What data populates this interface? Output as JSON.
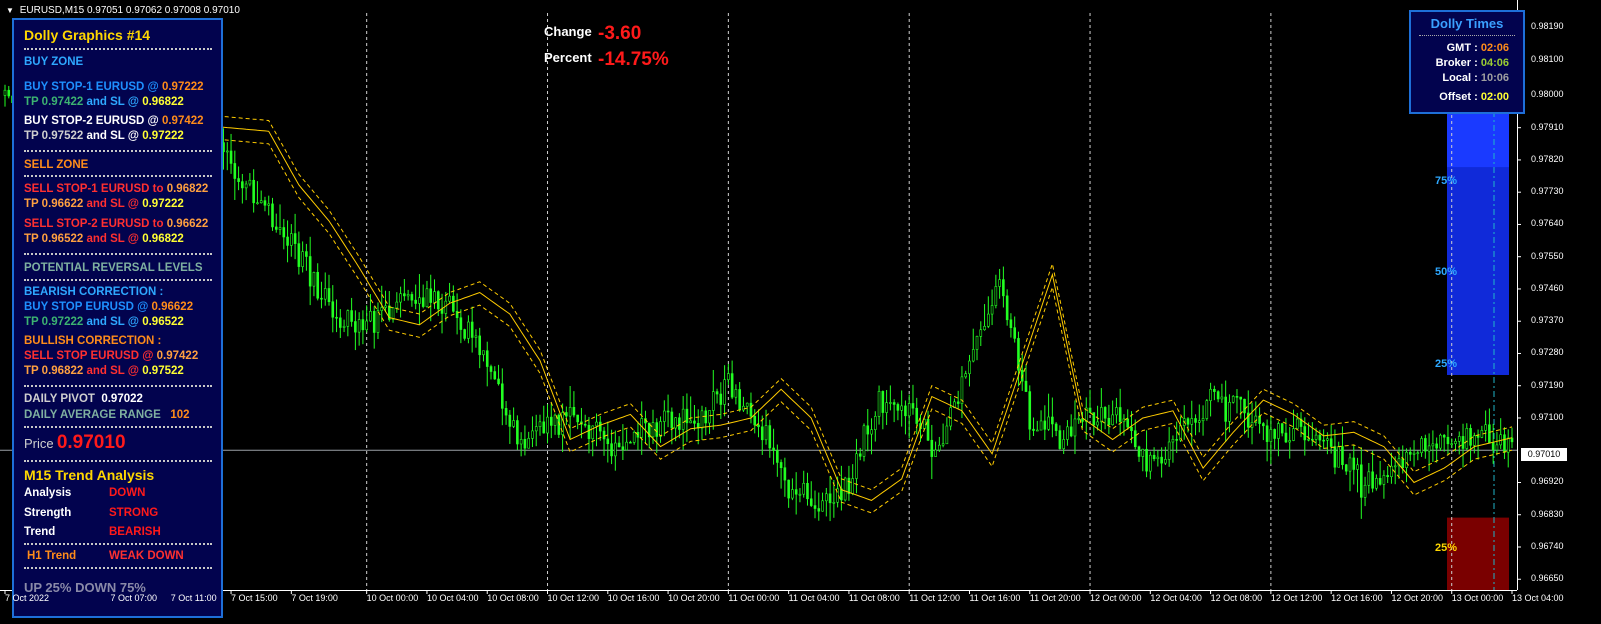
{
  "header": {
    "symbol": "EURUSD,M15",
    "ohlc": "0.97051 0.97062 0.97008 0.97010"
  },
  "change": {
    "change_label": "Change",
    "change_value": "-3.60",
    "percent_label": "Percent",
    "percent_value": "-14.75%"
  },
  "panel": {
    "title": "Dolly Graphics #14",
    "buy_zone": "BUY ZONE",
    "buy1_a": "BUY STOP-1  EURUSD  @",
    "buy1_price": "0.97222",
    "buy1_b": "TP 0.97422",
    "buy1_c": "and SL @",
    "buy1_sl": "0.96822",
    "buy2_a": "BUY STOP-2  EURUSD  @",
    "buy2_price": "0.97422",
    "buy2_b": "TP 0.97522",
    "buy2_c": "and SL @",
    "buy2_sl": "0.97222",
    "sell_zone": "SELL ZONE",
    "sell1_a": "SELL STOP-1  EURUSD to",
    "sell1_price": "0.96822",
    "sell1_b": "TP 0.96622",
    "sell1_c": "and SL @",
    "sell1_sl": "0.97222",
    "sell2_a": "SELL STOP-2  EURUSD to",
    "sell2_price": "0.96622",
    "sell2_b": "TP 0.96522",
    "sell2_c": "and SL @",
    "sell2_sl": "0.96822",
    "prl": "POTENTIAL REVERSAL LEVELS",
    "bear_title": "BEARISH CORRECTION :",
    "bear_a": "BUY STOP EURUSD  @",
    "bear_price": "0.96622",
    "bear_b": "TP 0.97222",
    "bear_c": "and SL @",
    "bear_sl": "0.96522",
    "bull_title": "BULLISH CORRECTION :",
    "bull_a": "SELL STOP EURUSD  @",
    "bull_price": "0.97422",
    "bull_b": "TP 0.96822",
    "bull_c": "and SL @",
    "bull_sl": "0.97522",
    "pivot_label": "DAILY PIVOT",
    "pivot_value": "0.97022",
    "dar_label": "DAILY AVERAGE RANGE",
    "dar_value": "102",
    "price_label": "Price",
    "price_value": "0.97010",
    "trend_title": "M15 Trend Analysis",
    "analysis_label": "Analysis",
    "analysis_value": "DOWN",
    "strength_label": "Strength",
    "strength_value": "STRONG",
    "trend_label": "Trend",
    "trend_value": "BEARISH",
    "h1_label": "H1 Trend",
    "h1_value": "WEAK DOWN",
    "updown": "UP 25%    DOWN 75%"
  },
  "dolly_times": {
    "title": "Dolly Times",
    "gmt_label": "GMT :",
    "gmt_value": "02:06",
    "broker_label": "Broker :",
    "broker_value": "04:06",
    "local_label": "Local :",
    "local_value": "10:06",
    "offset_label": "Offset :",
    "offset_value": "02:00"
  },
  "levels": {
    "p75": "75%",
    "p50": "50%",
    "p25a": "25%",
    "p25b": "25%"
  },
  "current_price": "0.97010",
  "price_axis": [
    "0.98190",
    "0.98100",
    "0.98000",
    "0.97910",
    "0.97820",
    "0.97730",
    "0.97640",
    "0.97550",
    "0.97460",
    "0.97370",
    "0.97280",
    "0.97190",
    "0.97100",
    "0.96920",
    "0.96830",
    "0.96740",
    "0.96650"
  ],
  "time_axis": [
    "7 Oct 2022",
    "7 Oct 07:00",
    "7 Oct 11:00",
    "7 Oct 15:00",
    "7 Oct 19:00",
    "10 Oct 00:00",
    "10 Oct 04:00",
    "10 Oct 08:00",
    "10 Oct 12:00",
    "10 Oct 16:00",
    "10 Oct 20:00",
    "11 Oct 00:00",
    "11 Oct 04:00",
    "11 Oct 08:00",
    "11 Oct 12:00",
    "11 Oct 16:00",
    "11 Oct 20:00",
    "12 Oct 00:00",
    "12 Oct 04:00",
    "12 Oct 08:00",
    "12 Oct 12:00",
    "12 Oct 16:00",
    "12 Oct 20:00",
    "13 Oct 00:00",
    "13 Oct 04:00"
  ],
  "chart_data": {
    "type": "line",
    "title": "",
    "ylim": [
      0.9662,
      0.9823
    ],
    "price_path": [
      [
        "7 Oct 00:00",
        0.98
      ],
      [
        "7 Oct 06:00",
        0.9793
      ],
      [
        "7 Oct 14:00",
        0.979
      ],
      [
        "7 Oct 16:00",
        0.9775
      ],
      [
        "7 Oct 18:00",
        0.9765
      ],
      [
        "7 Oct 20:00",
        0.9752
      ],
      [
        "7 Oct 22:00",
        0.9738
      ],
      [
        "10 Oct 00:00",
        0.9736
      ],
      [
        "10 Oct 02:00",
        0.9742
      ],
      [
        "10 Oct 04:00",
        0.9745
      ],
      [
        "10 Oct 06:00",
        0.9739
      ],
      [
        "10 Oct 08:00",
        0.9726
      ],
      [
        "10 Oct 10:00",
        0.9704
      ],
      [
        "10 Oct 12:00",
        0.9708
      ],
      [
        "10 Oct 14:00",
        0.9711
      ],
      [
        "10 Oct 16:00",
        0.9702
      ],
      [
        "10 Oct 18:00",
        0.9707
      ],
      [
        "10 Oct 20:00",
        0.9708
      ],
      [
        "10 Oct 22:00",
        0.971
      ],
      [
        "11 Oct 00:00",
        0.9718
      ],
      [
        "11 Oct 02:00",
        0.971
      ],
      [
        "11 Oct 04:00",
        0.969
      ],
      [
        "11 Oct 06:00",
        0.9687
      ],
      [
        "11 Oct 08:00",
        0.9693
      ],
      [
        "11 Oct 10:00",
        0.9716
      ],
      [
        "11 Oct 12:00",
        0.9712
      ],
      [
        "11 Oct 14:00",
        0.97
      ],
      [
        "11 Oct 16:00",
        0.9725
      ],
      [
        "11 Oct 18:00",
        0.975
      ],
      [
        "11 Oct 20:00",
        0.971
      ],
      [
        "11 Oct 22:00",
        0.9704
      ],
      [
        "12 Oct 00:00",
        0.971
      ],
      [
        "12 Oct 02:00",
        0.9712
      ],
      [
        "12 Oct 04:00",
        0.9696
      ],
      [
        "12 Oct 06:00",
        0.9706
      ],
      [
        "12 Oct 08:00",
        0.9715
      ],
      [
        "12 Oct 10:00",
        0.9711
      ],
      [
        "12 Oct 12:00",
        0.9705
      ],
      [
        "12 Oct 14:00",
        0.9706
      ],
      [
        "12 Oct 16:00",
        0.9702
      ],
      [
        "12 Oct 18:00",
        0.9692
      ],
      [
        "12 Oct 20:00",
        0.9696
      ],
      [
        "12 Oct 22:00",
        0.9702
      ],
      [
        "13 Oct 00:00",
        0.9704
      ],
      [
        "13 Oct 02:00",
        0.9706
      ],
      [
        "13 Oct 04:00",
        0.9701
      ]
    ]
  },
  "colors": {
    "candles": "#22ff22",
    "bands": "#ffcc00",
    "buy_zone": "#1a3aff",
    "sell_zone": "#7a0000",
    "panel_bg": "#02034e",
    "panel_border": "#1e6fd8"
  }
}
